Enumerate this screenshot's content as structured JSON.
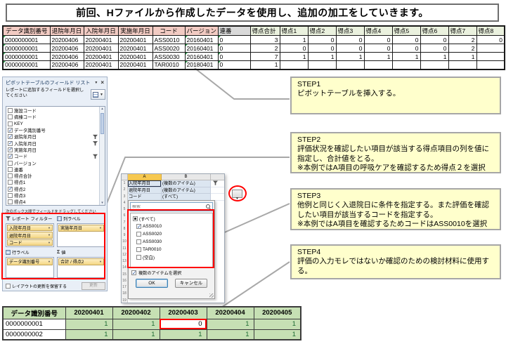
{
  "banner": {
    "text": "前回、Hファイルから作成したデータを使用し、追加の加工をしていきます。"
  },
  "data_table": {
    "headers": [
      "データ識別番号",
      "退院年月日",
      "入院年月日",
      "実施年月日",
      "コード",
      "バージョン",
      "連番",
      "得点合計",
      "得点1",
      "得点2",
      "得点3",
      "得点4",
      "得点5",
      "得点6",
      "得点7",
      "得点8"
    ],
    "rows": [
      [
        "0000000001",
        "20200406",
        "20200401",
        "20200401",
        "ASS0010",
        "20160401",
        "0",
        "3",
        "1",
        "0",
        "0",
        "0",
        "0",
        "0",
        "2",
        "0"
      ],
      [
        "0000000001",
        "20200406",
        "20200401",
        "20200401",
        "ASS0020",
        "20160401",
        "0",
        "2",
        "0",
        "0",
        "0",
        "0",
        "0",
        "0",
        "2",
        ""
      ],
      [
        "0000000001",
        "20200406",
        "20200401",
        "20200401",
        "ASS0030",
        "20160401",
        "0",
        "7",
        "1",
        "1",
        "1",
        "1",
        "1",
        "1",
        "1",
        ""
      ],
      [
        "0000000001",
        "20200406",
        "20200401",
        "20200401",
        "TAR0010",
        "20180401",
        "0",
        "1",
        "",
        "",
        "",
        "",
        "",
        "",
        "",
        ""
      ]
    ]
  },
  "field_list": {
    "title": "ピボットテーブルのフィールド リスト",
    "subtitle": "レポートに追加するフィールドを選択してください",
    "fields": [
      {
        "label": "施設コード",
        "checked": false
      },
      {
        "label": "病棟コード",
        "checked": false
      },
      {
        "label": "KEY",
        "checked": false
      },
      {
        "label": "データ識別番号",
        "checked": true
      },
      {
        "label": "退院年月日",
        "checked": true,
        "filtered": true
      },
      {
        "label": "入院年月日",
        "checked": true,
        "filtered": true
      },
      {
        "label": "実施年月日",
        "checked": true
      },
      {
        "label": "コード",
        "checked": true,
        "filtered": true
      },
      {
        "label": "バージョン",
        "checked": false
      },
      {
        "label": "連番",
        "checked": false
      },
      {
        "label": "得点合計",
        "checked": false
      },
      {
        "label": "得点1",
        "checked": false
      },
      {
        "label": "得点2",
        "checked": true
      },
      {
        "label": "得点3",
        "checked": false
      },
      {
        "label": "得点4",
        "checked": false
      }
    ],
    "drag_hint": "次のボックス間でフィールドをドラッグしてください",
    "areas": {
      "report_filter": {
        "title": "レポート フィルター",
        "items": [
          "入院年月日",
          "退院年月日",
          "コード"
        ]
      },
      "column_labels": {
        "title": "列ラベル",
        "items": [
          "実施年月日"
        ]
      },
      "row_labels": {
        "title": "行ラベル",
        "items": [
          "データ識別番号"
        ]
      },
      "values": {
        "sigma": "Σ",
        "title": "値",
        "items": [
          "合計 / 得点2"
        ]
      }
    },
    "defer_label": "レイアウトの更新を保留する",
    "update_button": "更新"
  },
  "filter_panel": {
    "col_a": "A",
    "col_b": "B",
    "rows": [
      {
        "num": "1",
        "field": "入院年月日",
        "value": "(複数のアイテム)"
      },
      {
        "num": "2",
        "field": "退院年月日",
        "value": "(複数のアイテム)"
      },
      {
        "num": "3",
        "field": "コード",
        "value": "(すべて)"
      }
    ],
    "row_numbers": [
      "1",
      "2",
      "3",
      "4",
      "5",
      "6",
      "7",
      "8",
      "9",
      "10",
      "11",
      "12",
      "13",
      "14",
      "15",
      "16",
      "17",
      "18",
      "19"
    ],
    "search_placeholder": "検索",
    "options": [
      {
        "label": "(すべて)",
        "state": "partial"
      },
      {
        "label": "ASS0010",
        "state": "checked"
      },
      {
        "label": "ASS0020",
        "state": "unchecked"
      },
      {
        "label": "ASS0030",
        "state": "unchecked"
      },
      {
        "label": "TAR0010",
        "state": "unchecked"
      },
      {
        "label": "(空白)",
        "state": "unchecked"
      }
    ],
    "multi_select_label": "複数のアイテムを選択",
    "ok_label": "OK",
    "cancel_label": "キャンセル"
  },
  "steps": [
    {
      "title": "STEP1",
      "lines": [
        "ピボットテーブルを挿入する。"
      ]
    },
    {
      "title": "STEP2",
      "lines": [
        "評価状況を確認したい項目が該当する得点項目の列を値に指定し、合計値をとる。",
        "※本例ではA項目の呼吸ケアを確認するため得点２を選択"
      ]
    },
    {
      "title": "STEP3",
      "lines": [
        "他例と同じく入退院日に条件を指定する。また評価を確認したい項目が該当するコードを指定する。",
        "※本例ではA項目を確認するためコードはASS0010を選択"
      ]
    },
    {
      "title": "STEP4",
      "lines": [
        "評価の入力モレではないか確認のための検討材料に使用する。"
      ]
    }
  ],
  "pivot_table": {
    "headers": [
      "データ識別番号",
      "20200401",
      "20200402",
      "20200403",
      "20200404",
      "20200405"
    ],
    "rows": [
      [
        "0000000001",
        "1",
        "1",
        "0",
        "1",
        "1"
      ],
      [
        "0000000002",
        "1",
        "1",
        "1",
        "1",
        "1"
      ]
    ]
  },
  "colors": {
    "annotation_red": "#FF0000",
    "step_bg": "#FFFFCC",
    "header_pink": "#F2CBC3",
    "header_green": "#EAF1DE",
    "header_gray": "#D9D9D9",
    "pivot_green": "#C6E0B4",
    "connector_gray": "#A8A8A8"
  }
}
